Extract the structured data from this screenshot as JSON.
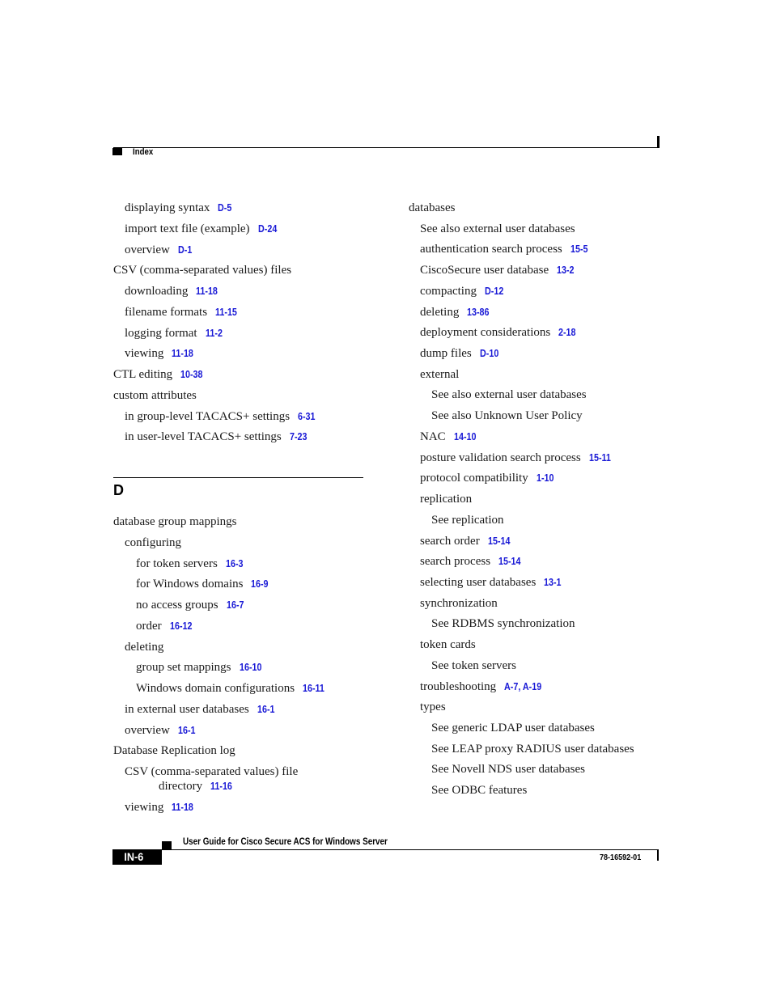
{
  "header": {
    "section_label": "Index"
  },
  "left_column": {
    "entries_top": [
      {
        "level": 1,
        "text": "displaying syntax",
        "ref": "D-5"
      },
      {
        "level": 1,
        "text": "import text file (example)",
        "ref": "D-24"
      },
      {
        "level": 1,
        "text": "overview",
        "ref": "D-1"
      },
      {
        "level": 0,
        "text": "CSV (comma-separated values) files",
        "ref": ""
      },
      {
        "level": 1,
        "text": "downloading",
        "ref": "11-18"
      },
      {
        "level": 1,
        "text": "filename formats",
        "ref": "11-15"
      },
      {
        "level": 1,
        "text": "logging format",
        "ref": "11-2"
      },
      {
        "level": 1,
        "text": "viewing",
        "ref": "11-18"
      },
      {
        "level": 0,
        "text": "CTL editing",
        "ref": "10-38"
      },
      {
        "level": 0,
        "text": "custom attributes",
        "ref": ""
      },
      {
        "level": 1,
        "text": "in group-level TACACS+ settings",
        "ref": "6-31"
      },
      {
        "level": 1,
        "text": "in user-level TACACS+ settings",
        "ref": "7-23"
      }
    ],
    "section_letter": "D",
    "entries_d": [
      {
        "level": 0,
        "text": "database group mappings",
        "ref": ""
      },
      {
        "level": 1,
        "text": "configuring",
        "ref": ""
      },
      {
        "level": 2,
        "text": "for token servers",
        "ref": "16-3"
      },
      {
        "level": 2,
        "text": "for Windows domains",
        "ref": "16-9"
      },
      {
        "level": 2,
        "text": "no access groups",
        "ref": "16-7"
      },
      {
        "level": 2,
        "text": "order",
        "ref": "16-12"
      },
      {
        "level": 1,
        "text": "deleting",
        "ref": ""
      },
      {
        "level": 2,
        "text": "group set mappings",
        "ref": "16-10"
      },
      {
        "level": 2,
        "text": "Windows domain configurations",
        "ref": "16-11"
      },
      {
        "level": 1,
        "text": "in external user databases",
        "ref": "16-1"
      },
      {
        "level": 1,
        "text": "overview",
        "ref": "16-1"
      },
      {
        "level": 0,
        "text": "Database Replication log",
        "ref": ""
      },
      {
        "level": 1,
        "text": "CSV (comma-separated values) file",
        "ref": ""
      },
      {
        "level": 3,
        "text": "directory",
        "ref": "11-16"
      },
      {
        "level": 1,
        "text": "viewing",
        "ref": "11-18"
      }
    ]
  },
  "right_column": {
    "entries": [
      {
        "level": 0,
        "text": "databases",
        "ref": ""
      },
      {
        "level": 1,
        "text": "See also external user databases",
        "ref": ""
      },
      {
        "level": 1,
        "text": "authentication search process",
        "ref": "15-5"
      },
      {
        "level": 1,
        "text": "CiscoSecure user database",
        "ref": "13-2"
      },
      {
        "level": 1,
        "text": "compacting",
        "ref": "D-12"
      },
      {
        "level": 1,
        "text": "deleting",
        "ref": "13-86"
      },
      {
        "level": 1,
        "text": "deployment considerations",
        "ref": "2-18"
      },
      {
        "level": 1,
        "text": "dump files",
        "ref": "D-10"
      },
      {
        "level": 1,
        "text": "external",
        "ref": ""
      },
      {
        "level": 2,
        "text": "See also external user databases",
        "ref": ""
      },
      {
        "level": 2,
        "text": "See also Unknown User Policy",
        "ref": ""
      },
      {
        "level": 1,
        "text": "NAC",
        "ref": "14-10"
      },
      {
        "level": 1,
        "text": "posture validation search process",
        "ref": "15-11"
      },
      {
        "level": 1,
        "text": "protocol compatibility",
        "ref": "1-10"
      },
      {
        "level": 1,
        "text": "replication",
        "ref": ""
      },
      {
        "level": 2,
        "text": "See replication",
        "ref": ""
      },
      {
        "level": 1,
        "text": "search order",
        "ref": "15-14"
      },
      {
        "level": 1,
        "text": "search process",
        "ref": "15-14"
      },
      {
        "level": 1,
        "text": "selecting user databases",
        "ref": "13-1"
      },
      {
        "level": 1,
        "text": "synchronization",
        "ref": ""
      },
      {
        "level": 2,
        "text": "See RDBMS synchronization",
        "ref": ""
      },
      {
        "level": 1,
        "text": "token cards",
        "ref": ""
      },
      {
        "level": 2,
        "text": "See token servers",
        "ref": ""
      },
      {
        "level": 1,
        "text": "troubleshooting",
        "ref": "A-7, A-19"
      },
      {
        "level": 1,
        "text": "types",
        "ref": ""
      },
      {
        "level": 2,
        "text": "See generic LDAP user databases",
        "ref": ""
      },
      {
        "level": 2,
        "text": "See LEAP proxy RADIUS user databases",
        "ref": ""
      },
      {
        "level": 2,
        "text": "See Novell NDS user databases",
        "ref": ""
      },
      {
        "level": 2,
        "text": "See ODBC features",
        "ref": ""
      }
    ]
  },
  "footer": {
    "guide_title": "User Guide for Cisco Secure ACS for Windows Server",
    "page_number": "IN-6",
    "doc_number": "78-16592-01"
  },
  "colors": {
    "link": "#1a1ad6",
    "text": "#1a1a1a",
    "rule": "#000000"
  }
}
